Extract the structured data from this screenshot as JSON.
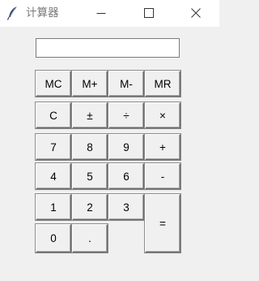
{
  "window": {
    "title": "计算器",
    "icon": "feather-icon"
  },
  "display": {
    "value": ""
  },
  "keys": {
    "mc": "MC",
    "mplus": "M+",
    "mminus": "M-",
    "mr": "MR",
    "clear": "C",
    "negate": "±",
    "divide": "÷",
    "multiply": "×",
    "seven": "7",
    "eight": "8",
    "nine": "9",
    "plus": "+",
    "four": "4",
    "five": "5",
    "six": "6",
    "minus": "-",
    "one": "1",
    "two": "2",
    "three": "3",
    "equals": "=",
    "zero": "0",
    "decimal": "."
  }
}
